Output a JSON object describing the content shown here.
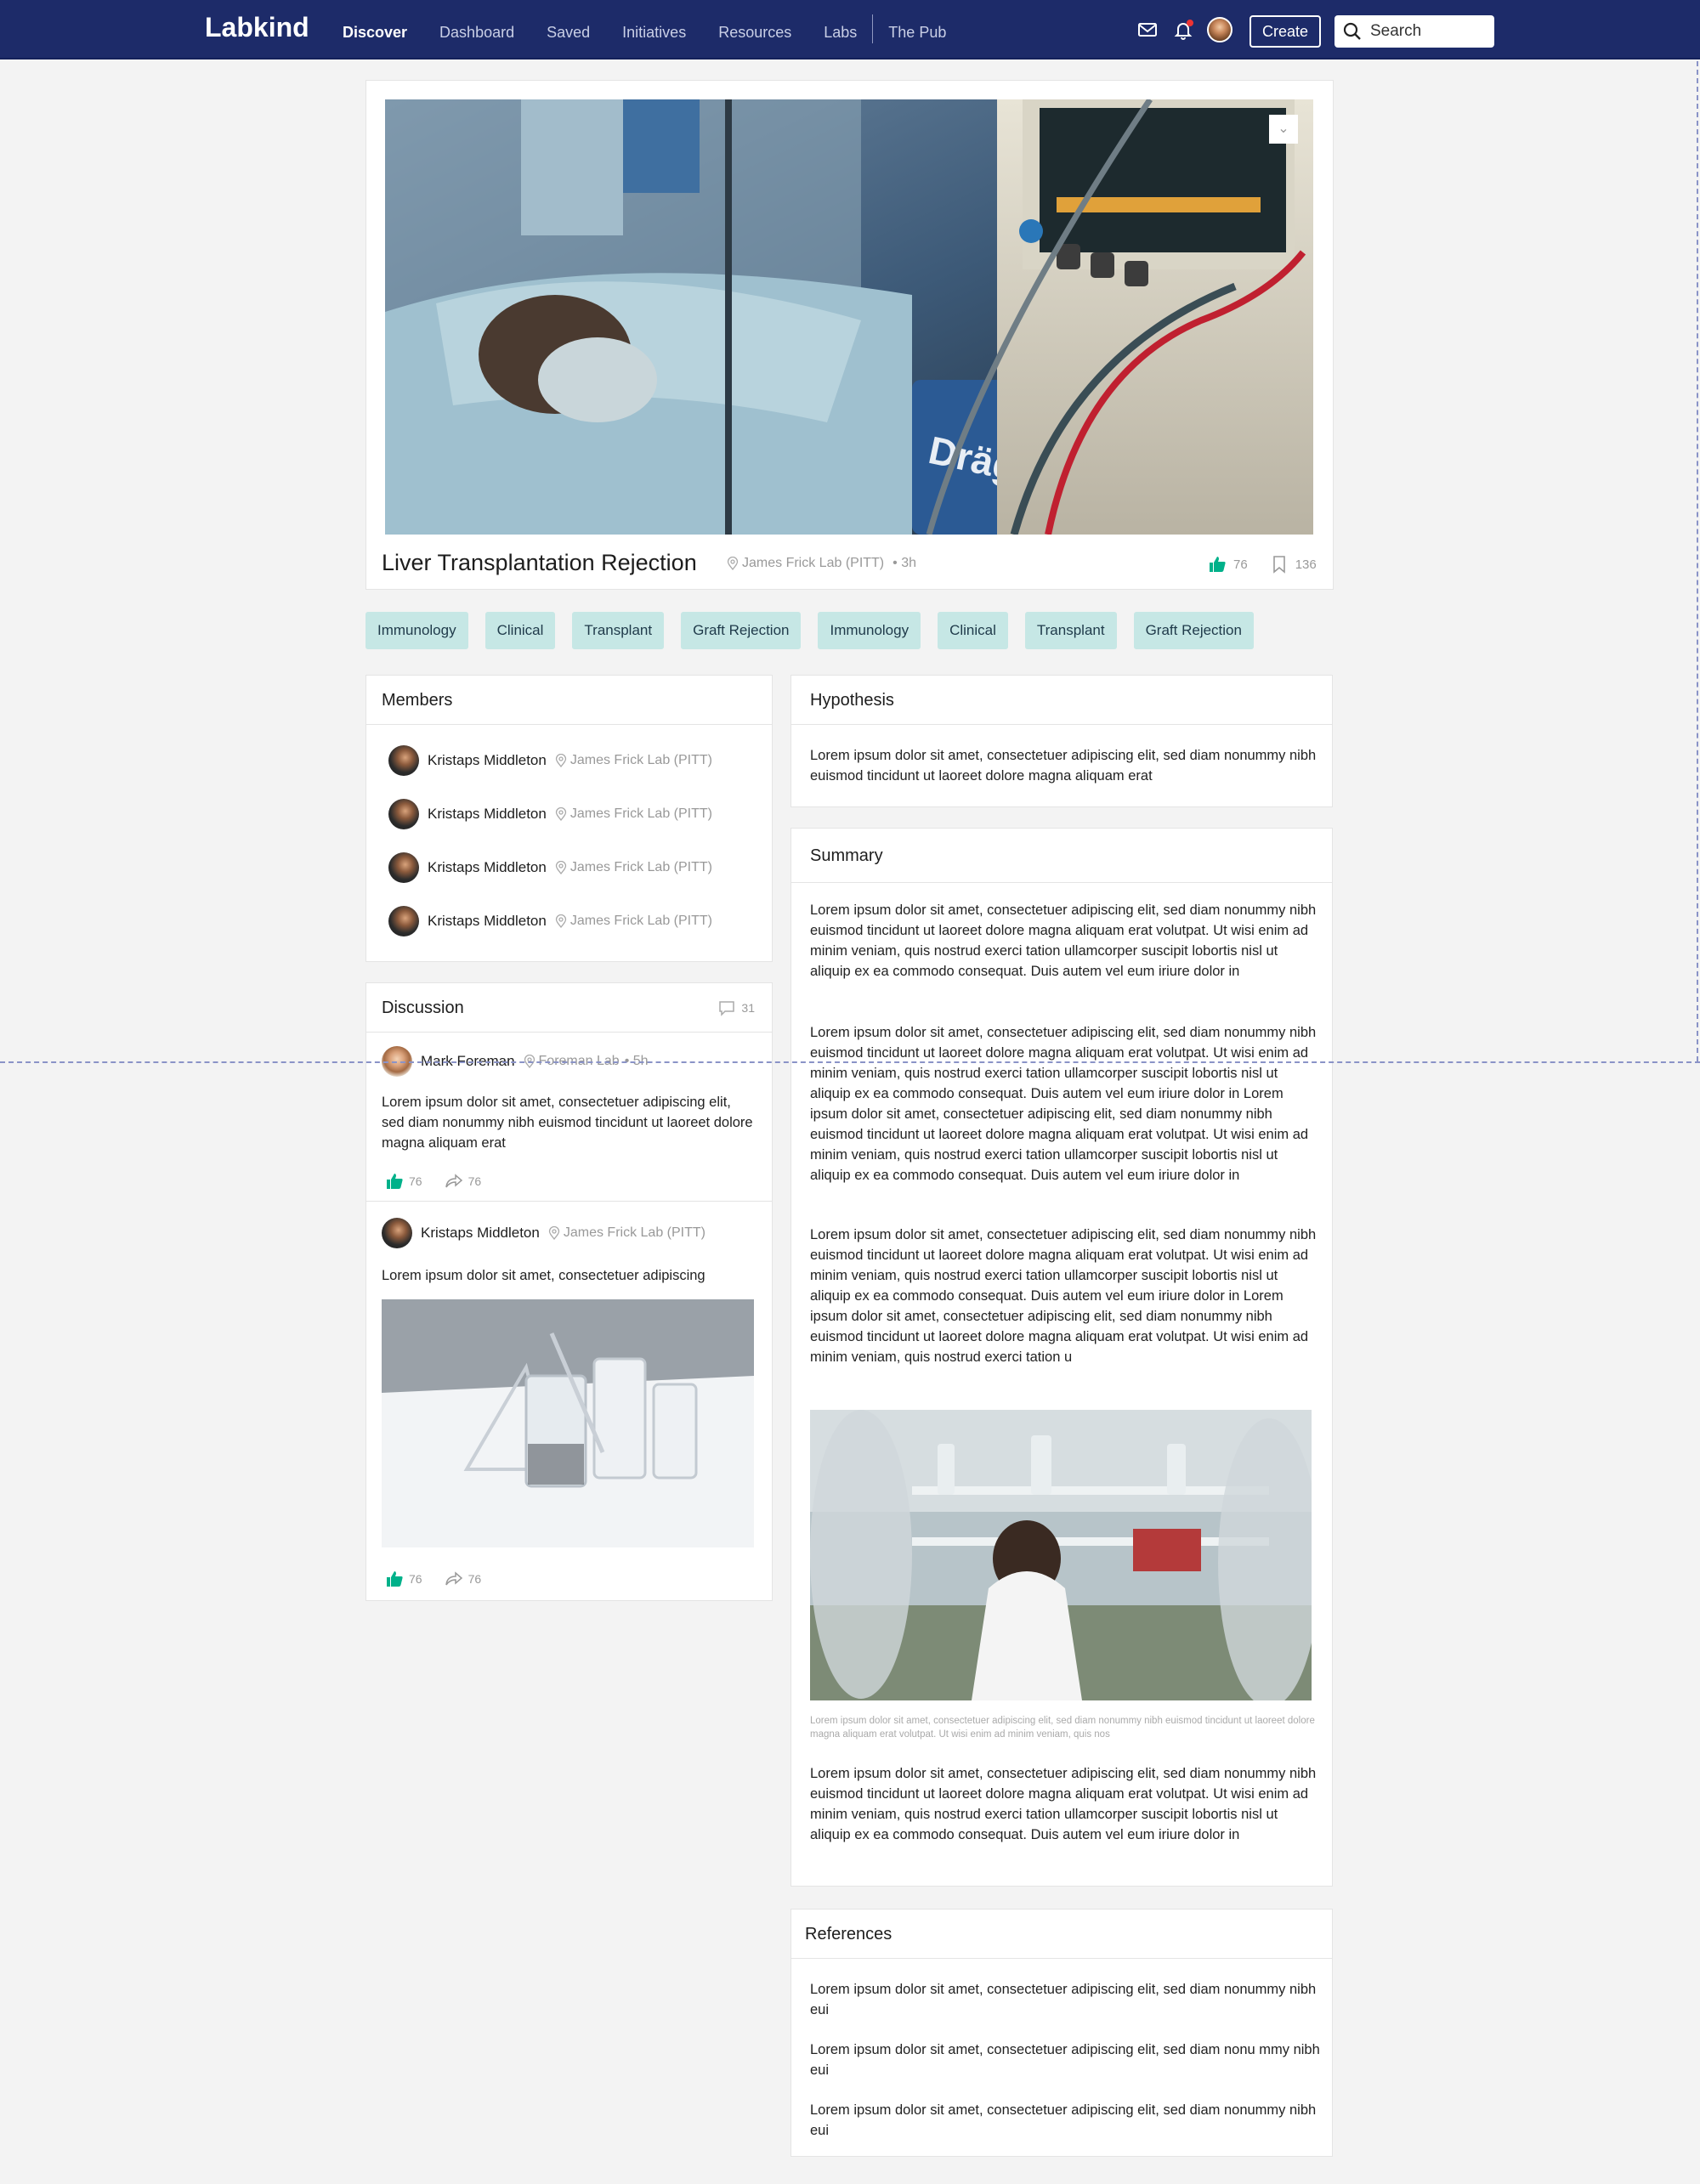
{
  "nav": {
    "brand": "Labkind",
    "links": [
      "Discover",
      "Dashboard",
      "Saved",
      "Initiatives",
      "Resources",
      "Labs",
      "The Pub"
    ],
    "active": "Discover",
    "create_label": "Create",
    "search_placeholder": "Search",
    "brand_color": "#1d2b69"
  },
  "project": {
    "title": "Liver Transplantation Rejection",
    "lab": "James Frick Lab (PITT)",
    "time": "• 3h",
    "likes": "76",
    "saves": "136"
  },
  "tags": [
    "Immunology",
    "Clinical",
    "Transplant",
    "Graft Rejection",
    "Immunology",
    "Clinical",
    "Transplant",
    "Graft Rejection"
  ],
  "members": {
    "title": "Members",
    "items": [
      {
        "name": "Kristaps Middleton",
        "lab": "James Frick Lab (PITT)"
      },
      {
        "name": "Kristaps Middleton",
        "lab": "James Frick Lab (PITT)"
      },
      {
        "name": "Kristaps Middleton",
        "lab": "James Frick Lab (PITT)"
      },
      {
        "name": "Kristaps Middleton",
        "lab": "James Frick Lab (PITT)"
      }
    ]
  },
  "discussion": {
    "title": "Discussion",
    "count": "31",
    "posts": [
      {
        "author": "Mark Foreman",
        "lab": "Foreman Lab",
        "time": "• 5h",
        "text": "Lorem ipsum dolor sit amet, consectetuer adipiscing elit, sed diam nonummy nibh euismod tincidunt ut laoreet dolore magna aliquam erat",
        "likes": "76",
        "shares": "76"
      },
      {
        "author": "Kristaps Middleton",
        "lab": "James Frick Lab (PITT)",
        "time": "",
        "text": "Lorem ipsum dolor sit amet, consectetuer adipiscing",
        "likes": "76",
        "shares": "76"
      }
    ]
  },
  "hypothesis": {
    "title": "Hypothesis",
    "text": "Lorem ipsum dolor sit amet, consectetuer adipiscing elit, sed diam nonummy nibh euismod tincidunt ut laoreet dolore magna aliquam erat"
  },
  "summary": {
    "title": "Summary",
    "paragraphs": [
      "Lorem ipsum dolor sit amet, consectetuer adipiscing elit, sed diam nonummy nibh euismod tincidunt ut laoreet dolore magna aliquam erat volutpat. Ut wisi enim ad minim veniam, quis nostrud exerci tation ullamcorper suscipit lobortis nisl ut aliquip ex ea commodo consequat. Duis autem vel eum iriure dolor in",
      "Lorem ipsum dolor sit amet, consectetuer adipiscing elit, sed diam nonummy nibh euismod tincidunt ut laoreet dolore magna aliquam erat volutpat. Ut wisi enim ad minim veniam, quis nostrud exerci tation ullamcorper suscipit lobortis nisl ut aliquip ex ea commodo consequat. Duis autem vel eum iriure dolor in Lorem ipsum dolor sit amet, consectetuer adipiscing elit, sed diam nonummy nibh euismod tincidunt ut laoreet dolore magna aliquam erat volutpat. Ut wisi enim ad minim veniam, quis nostrud exerci tation ullamcorper suscipit lobortis nisl ut aliquip ex ea commodo consequat. Duis autem vel eum iriure dolor in",
      "Lorem ipsum dolor sit amet, consectetuer adipiscing elit, sed diam nonummy nibh euismod tincidunt ut laoreet dolore magna aliquam erat volutpat. Ut wisi enim ad minim veniam, quis nostrud exerci tation ullamcorper suscipit lobortis nisl ut aliquip ex ea commodo consequat. Duis autem vel eum iriure dolor in Lorem ipsum dolor sit amet, consectetuer adipiscing elit, sed diam nonummy nibh euismod tincidunt ut laoreet dolore magna aliquam erat volutpat. Ut wisi enim ad minim veniam, quis nostrud exerci tation u",
      "Lorem ipsum dolor sit amet, consectetuer adipiscing elit, sed diam nonummy nibh euismod tincidunt ut laoreet dolore magna aliquam erat volutpat. Ut wisi enim ad minim veniam, quis nostrud exerci tation ullamcorper suscipit lobortis nisl ut aliquip ex ea commodo consequat. Duis autem vel eum iriure dolor in"
    ],
    "caption": "Lorem ipsum dolor sit amet, consectetuer adipiscing elit, sed diam nonummy nibh euismod tincidunt ut laoreet dolore magna aliquam erat volutpat. Ut wisi enim ad minim veniam, quis nos"
  },
  "references": {
    "title": "References",
    "items": [
      "Lorem ipsum dolor sit amet, consectetuer adipiscing elit, sed diam nonummy nibh eui",
      "Lorem ipsum dolor sit amet, consectetuer adipiscing elit, sed diam nonu mmy nibh eui",
      "Lorem ipsum dolor sit amet, consectetuer adipiscing elit, sed diam nonummy nibh eui"
    ]
  },
  "colors": {
    "accent": "#00b18a",
    "tag_bg": "#c6e7e5",
    "nav_bg": "#1d2b69"
  }
}
